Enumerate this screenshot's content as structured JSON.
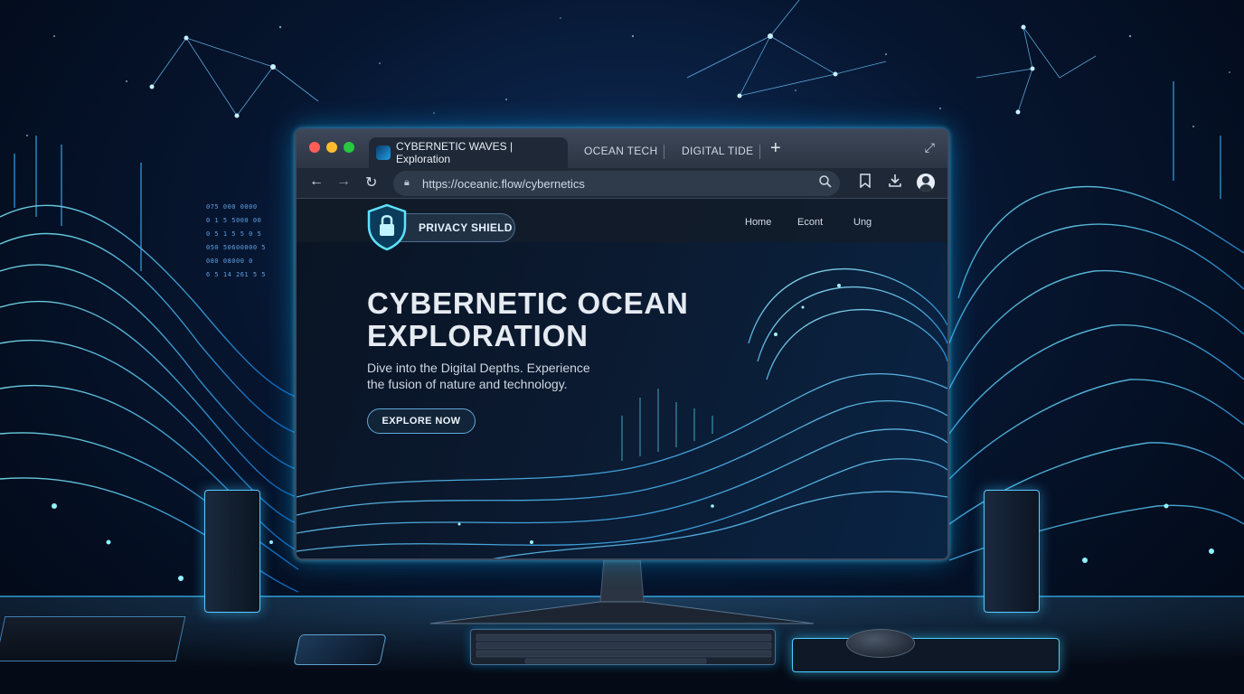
{
  "browser": {
    "active_tab": "CYBERNETIC WAVES | Exploration",
    "tabs": [
      "OCEAN TECH",
      "DIGITAL TIDE"
    ],
    "new_tab_symbol": "+",
    "url": "https://oceanic.flow/cybernetics",
    "icons": [
      "back-arrow-icon",
      "forward-arrow-icon",
      "reload-icon",
      "lock-icon",
      "search-icon",
      "bookmark-icon",
      "download-icon",
      "profile-avatar-icon",
      "expand-icon"
    ]
  },
  "page": {
    "shield_label": "PRIVACY SHIELD",
    "nav": [
      "Home",
      "Econt",
      "Ung"
    ],
    "hero_title_line1": "CYBERNETIC OCEAN",
    "hero_title_line2": "EXPLORATION",
    "hero_subtitle_line1": "Dive into the Digital Depths. Experience",
    "hero_subtitle_line2": "the fusion of nature and technology.",
    "cta_label": "EXPLORE NOW"
  },
  "background": {
    "data_rows": [
      "075  000   0000",
      "0 1 5  5000  00",
      "0 5 1   5 5 0 5",
      "050  50600000 5",
      "080  08000   0",
      "6 5  14 261 5 5"
    ]
  },
  "colors": {
    "glow": "#2ec8ff",
    "accent": "#5fa8d8",
    "bg_dark": "#06152f"
  }
}
